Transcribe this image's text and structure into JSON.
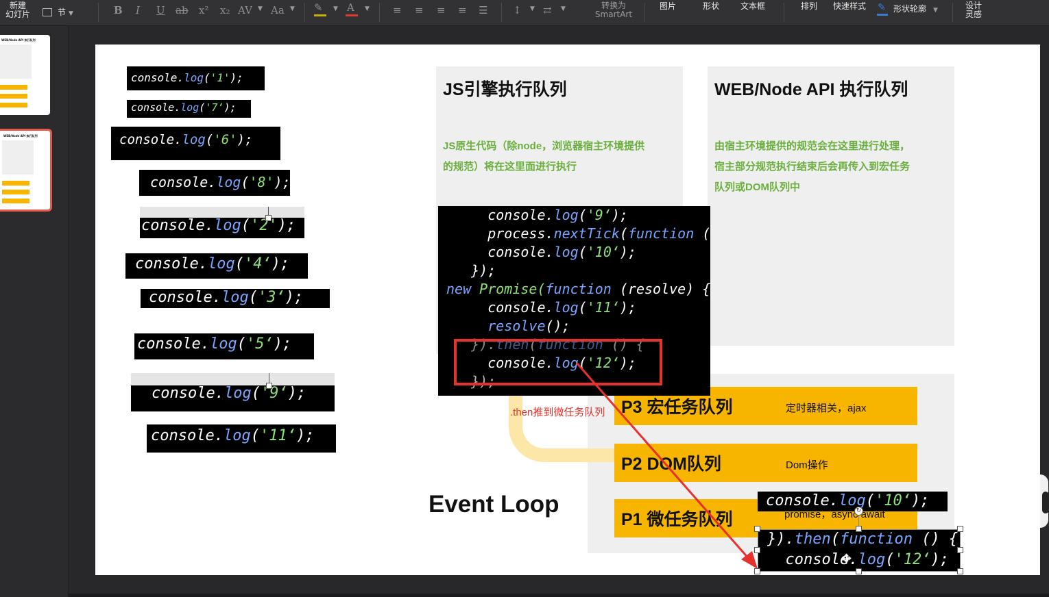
{
  "ribbon": {
    "new_slide_line1": "新建",
    "new_slide_line2": "幻灯片",
    "section_label": "节",
    "bold_glyph": "B",
    "italic_glyph": "I",
    "underline_glyph": "U",
    "strike_glyph": "ab",
    "superscript_glyph": "x²",
    "subscript_glyph": "x₂",
    "spacing_glyph": "AV",
    "case_glyph": "Aa",
    "font_color_glyph": "A",
    "convert_smartart_line1": "转换为",
    "convert_smartart_line2": "SmartArt",
    "picture": "图片",
    "shape": "形状",
    "textbox": "文本框",
    "arrange": "排列",
    "quick_styles": "快速样式",
    "shape_outline": "形状轮廓",
    "designer_line1": "设计",
    "designer_line2": "灵感",
    "colors": {
      "highlight": "#c8b400",
      "font": "#e03a2f",
      "outline_icon": "#3a7bd5"
    }
  },
  "thumbnails": {
    "slide1": {
      "title": "WEB/Node API 执行队列",
      "side_labels": [
        "列",
        "列",
        "列"
      ]
    },
    "slide2": {
      "title": "WEB/Node API 执行队列",
      "side_labels": [
        "列",
        "列",
        "列"
      ],
      "selected": true,
      "accent": "#e55a4a"
    }
  },
  "slide": {
    "snippets": [
      {
        "obj": "console",
        "fn": "log",
        "arg": "'1'"
      },
      {
        "obj": "console",
        "fn": "log",
        "arg": "'7‘"
      },
      {
        "obj": "console",
        "fn": "log",
        "arg": "'6'"
      },
      {
        "obj": "console",
        "fn": "log",
        "arg": "'8'"
      },
      {
        "obj": "console",
        "fn": "log",
        "arg": "'2'"
      },
      {
        "obj": "console",
        "fn": "log",
        "arg": "'4‘"
      },
      {
        "obj": "console",
        "fn": "log",
        "arg": "'3‘"
      },
      {
        "obj": "console",
        "fn": "log",
        "arg": "'5‘"
      },
      {
        "obj": "console",
        "fn": "log",
        "arg": "'9‘"
      },
      {
        "obj": "console",
        "fn": "log",
        "arg": "'11‘"
      }
    ],
    "js_panel": {
      "title": "JS引擎执行队列",
      "desc_line1": "JS原生代码（除node，浏览器宿主环境提供",
      "desc_line2": "的规范）将在这里面进行执行"
    },
    "web_panel": {
      "title": "WEB/Node API 执行队列",
      "desc_line1": "由宿主环境提供的规范会在这里进行处理，",
      "desc_line2": "宿主部分规范执行结束后会再传入到宏任务",
      "desc_line3": "队列或DOM队列中"
    },
    "big_code": {
      "l1_fn": "console",
      "l1_m": "log",
      "l1_arg": "'9‘",
      "l2_obj": "process",
      "l2_m": "nextTick",
      "l2_kw": "function",
      "l2_rest": " () {",
      "l3_fn": "console",
      "l3_m": "log",
      "l3_arg": "'10‘",
      "l4": "});",
      "l5_kw": "new",
      "l5_cls": " Promise(",
      "l5_fn": "function",
      "l5_rest": " (resolve) {",
      "l6_fn": "console",
      "l6_m": "log",
      "l6_arg": "'11‘",
      "l7_m": "resolve",
      "l8_pre": "}).",
      "l8_m": "then",
      "l8_kw": "function",
      "l8_rest": " () {",
      "l9_fn": "console",
      "l9_m": "log",
      "l9_arg": "'12‘",
      "l10": "});"
    },
    "annotation": ".then推到微任务队列",
    "event_loop": "Event Loop",
    "queues": [
      {
        "name": "P3 宏任务队列",
        "note": "定时器相关，ajax"
      },
      {
        "name": "P2 DOM队列",
        "note": "Dom操作"
      },
      {
        "name": "P1 微任务队列",
        "note": "promise，async await"
      }
    ],
    "snippet_10": {
      "obj": "console",
      "fn": "log",
      "arg": "'10‘"
    },
    "then_snippet": {
      "l1_pre": "}).",
      "l1_m": "then",
      "l1_kw": "function",
      "l1_rest": " () {",
      "l2_fn": "console",
      "l2_m": "log",
      "l2_arg": "'12‘"
    },
    "colors": {
      "accent_yellow": "#f7b500",
      "green_text": "#6aaf3d",
      "red_box": "#e5322d",
      "code_keyword": "#7aa6ff",
      "code_string": "#8ee07a"
    }
  }
}
